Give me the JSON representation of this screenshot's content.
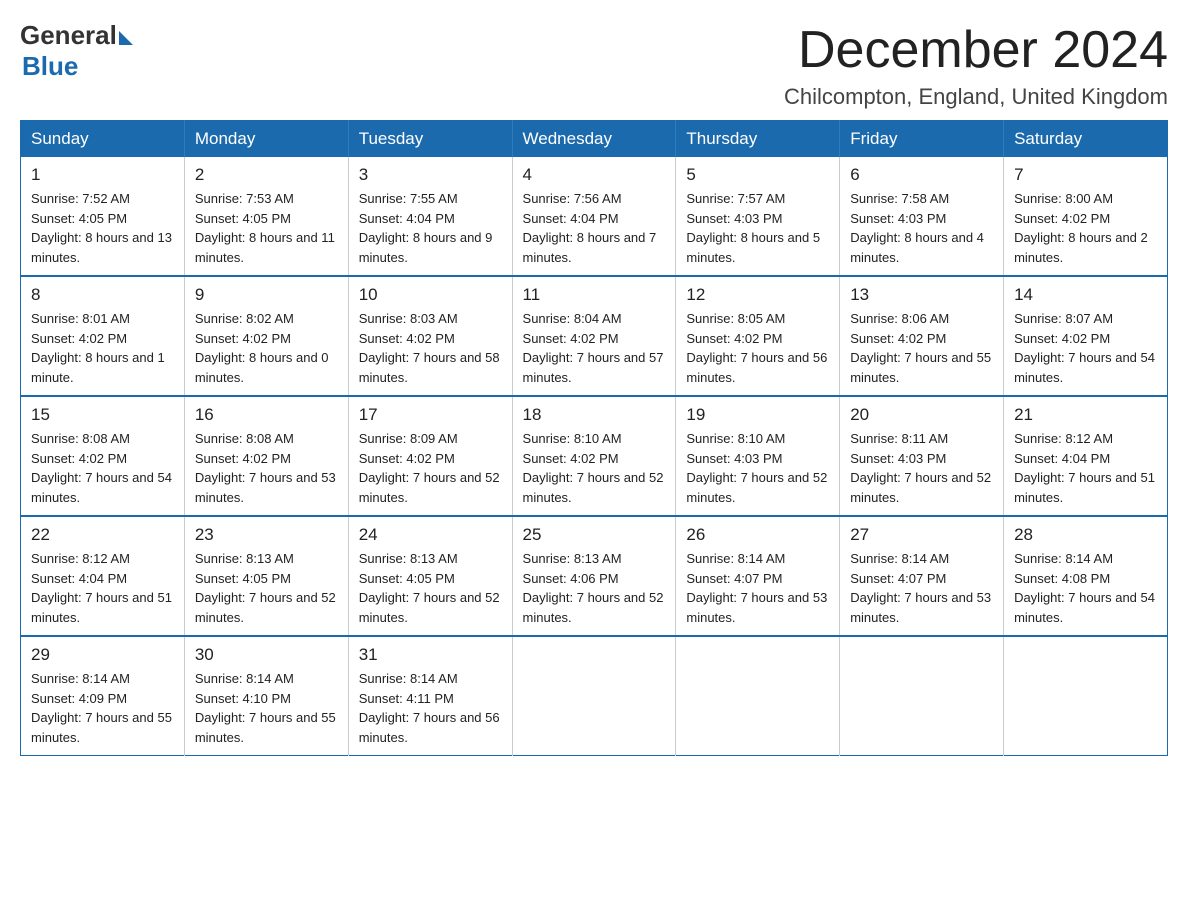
{
  "logo": {
    "general": "General",
    "blue": "Blue"
  },
  "header": {
    "title": "December 2024",
    "subtitle": "Chilcompton, England, United Kingdom"
  },
  "weekdays": [
    "Sunday",
    "Monday",
    "Tuesday",
    "Wednesday",
    "Thursday",
    "Friday",
    "Saturday"
  ],
  "weeks": [
    [
      {
        "day": "1",
        "sunrise": "7:52 AM",
        "sunset": "4:05 PM",
        "daylight": "8 hours and 13 minutes."
      },
      {
        "day": "2",
        "sunrise": "7:53 AM",
        "sunset": "4:05 PM",
        "daylight": "8 hours and 11 minutes."
      },
      {
        "day": "3",
        "sunrise": "7:55 AM",
        "sunset": "4:04 PM",
        "daylight": "8 hours and 9 minutes."
      },
      {
        "day": "4",
        "sunrise": "7:56 AM",
        "sunset": "4:04 PM",
        "daylight": "8 hours and 7 minutes."
      },
      {
        "day": "5",
        "sunrise": "7:57 AM",
        "sunset": "4:03 PM",
        "daylight": "8 hours and 5 minutes."
      },
      {
        "day": "6",
        "sunrise": "7:58 AM",
        "sunset": "4:03 PM",
        "daylight": "8 hours and 4 minutes."
      },
      {
        "day": "7",
        "sunrise": "8:00 AM",
        "sunset": "4:02 PM",
        "daylight": "8 hours and 2 minutes."
      }
    ],
    [
      {
        "day": "8",
        "sunrise": "8:01 AM",
        "sunset": "4:02 PM",
        "daylight": "8 hours and 1 minute."
      },
      {
        "day": "9",
        "sunrise": "8:02 AM",
        "sunset": "4:02 PM",
        "daylight": "8 hours and 0 minutes."
      },
      {
        "day": "10",
        "sunrise": "8:03 AM",
        "sunset": "4:02 PM",
        "daylight": "7 hours and 58 minutes."
      },
      {
        "day": "11",
        "sunrise": "8:04 AM",
        "sunset": "4:02 PM",
        "daylight": "7 hours and 57 minutes."
      },
      {
        "day": "12",
        "sunrise": "8:05 AM",
        "sunset": "4:02 PM",
        "daylight": "7 hours and 56 minutes."
      },
      {
        "day": "13",
        "sunrise": "8:06 AM",
        "sunset": "4:02 PM",
        "daylight": "7 hours and 55 minutes."
      },
      {
        "day": "14",
        "sunrise": "8:07 AM",
        "sunset": "4:02 PM",
        "daylight": "7 hours and 54 minutes."
      }
    ],
    [
      {
        "day": "15",
        "sunrise": "8:08 AM",
        "sunset": "4:02 PM",
        "daylight": "7 hours and 54 minutes."
      },
      {
        "day": "16",
        "sunrise": "8:08 AM",
        "sunset": "4:02 PM",
        "daylight": "7 hours and 53 minutes."
      },
      {
        "day": "17",
        "sunrise": "8:09 AM",
        "sunset": "4:02 PM",
        "daylight": "7 hours and 52 minutes."
      },
      {
        "day": "18",
        "sunrise": "8:10 AM",
        "sunset": "4:02 PM",
        "daylight": "7 hours and 52 minutes."
      },
      {
        "day": "19",
        "sunrise": "8:10 AM",
        "sunset": "4:03 PM",
        "daylight": "7 hours and 52 minutes."
      },
      {
        "day": "20",
        "sunrise": "8:11 AM",
        "sunset": "4:03 PM",
        "daylight": "7 hours and 52 minutes."
      },
      {
        "day": "21",
        "sunrise": "8:12 AM",
        "sunset": "4:04 PM",
        "daylight": "7 hours and 51 minutes."
      }
    ],
    [
      {
        "day": "22",
        "sunrise": "8:12 AM",
        "sunset": "4:04 PM",
        "daylight": "7 hours and 51 minutes."
      },
      {
        "day": "23",
        "sunrise": "8:13 AM",
        "sunset": "4:05 PM",
        "daylight": "7 hours and 52 minutes."
      },
      {
        "day": "24",
        "sunrise": "8:13 AM",
        "sunset": "4:05 PM",
        "daylight": "7 hours and 52 minutes."
      },
      {
        "day": "25",
        "sunrise": "8:13 AM",
        "sunset": "4:06 PM",
        "daylight": "7 hours and 52 minutes."
      },
      {
        "day": "26",
        "sunrise": "8:14 AM",
        "sunset": "4:07 PM",
        "daylight": "7 hours and 53 minutes."
      },
      {
        "day": "27",
        "sunrise": "8:14 AM",
        "sunset": "4:07 PM",
        "daylight": "7 hours and 53 minutes."
      },
      {
        "day": "28",
        "sunrise": "8:14 AM",
        "sunset": "4:08 PM",
        "daylight": "7 hours and 54 minutes."
      }
    ],
    [
      {
        "day": "29",
        "sunrise": "8:14 AM",
        "sunset": "4:09 PM",
        "daylight": "7 hours and 55 minutes."
      },
      {
        "day": "30",
        "sunrise": "8:14 AM",
        "sunset": "4:10 PM",
        "daylight": "7 hours and 55 minutes."
      },
      {
        "day": "31",
        "sunrise": "8:14 AM",
        "sunset": "4:11 PM",
        "daylight": "7 hours and 56 minutes."
      },
      null,
      null,
      null,
      null
    ]
  ]
}
